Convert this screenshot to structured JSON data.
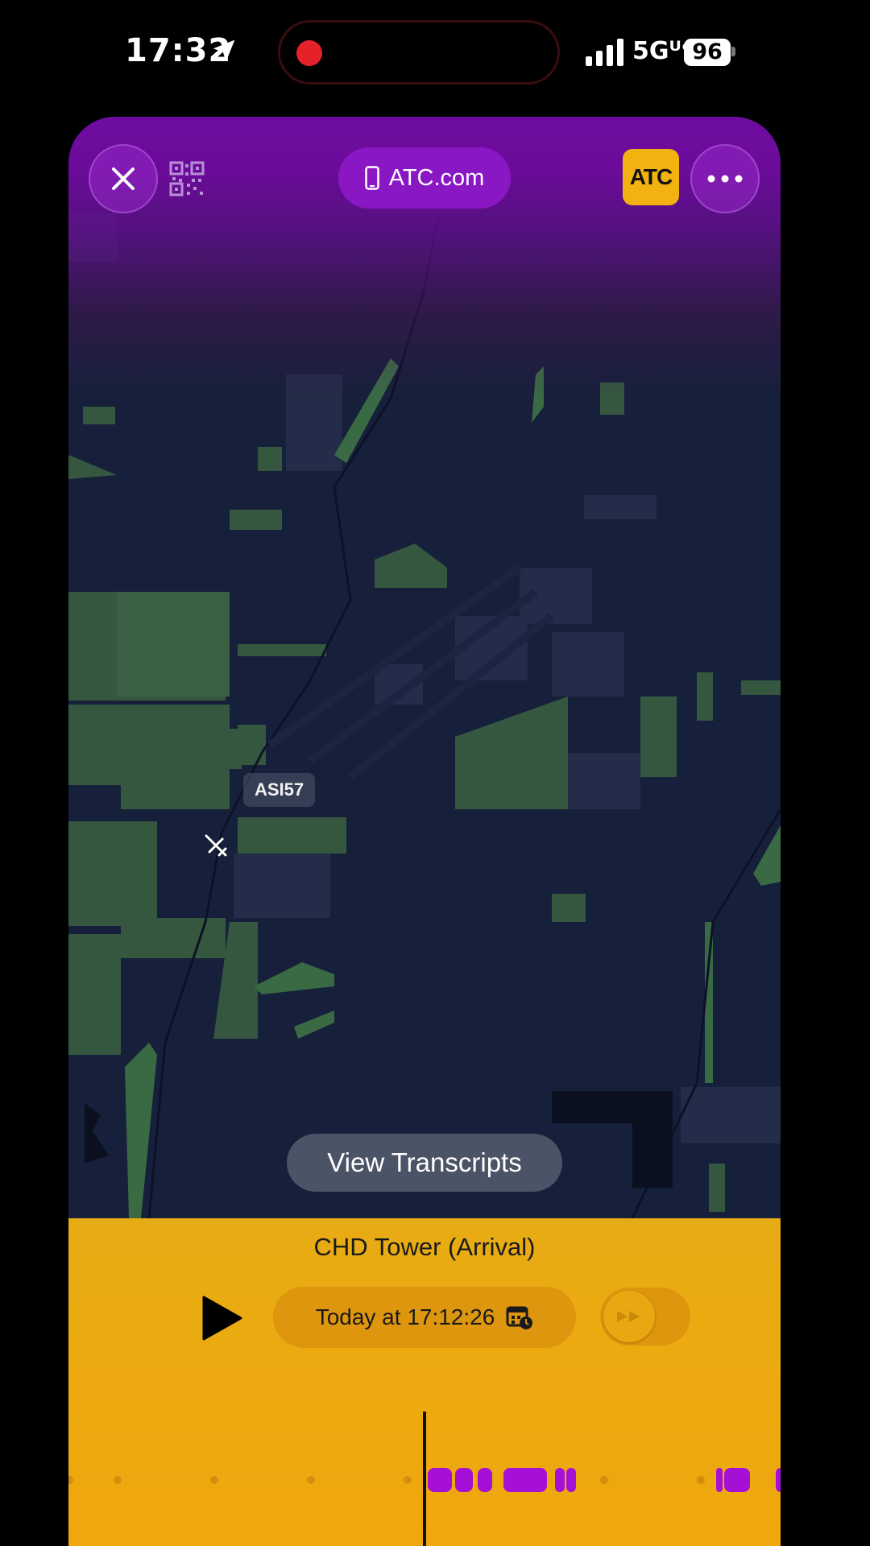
{
  "status_bar": {
    "time": "17:32",
    "network": "5Gᵁᶜ",
    "battery": "96"
  },
  "header": {
    "url": "ATC.com",
    "logo_text": "ATC",
    "icons": [
      "close-icon",
      "qr-code-icon",
      "phone-icon",
      "more-icon"
    ]
  },
  "map": {
    "aircraft_label": "ASI57",
    "view_transcripts": "View Transcripts"
  },
  "player": {
    "title": "CHD Tower (Arrival)",
    "timestamp": "Today at 17:12:26",
    "accent": "#ebab10",
    "segment_color": "#a50fd6"
  }
}
